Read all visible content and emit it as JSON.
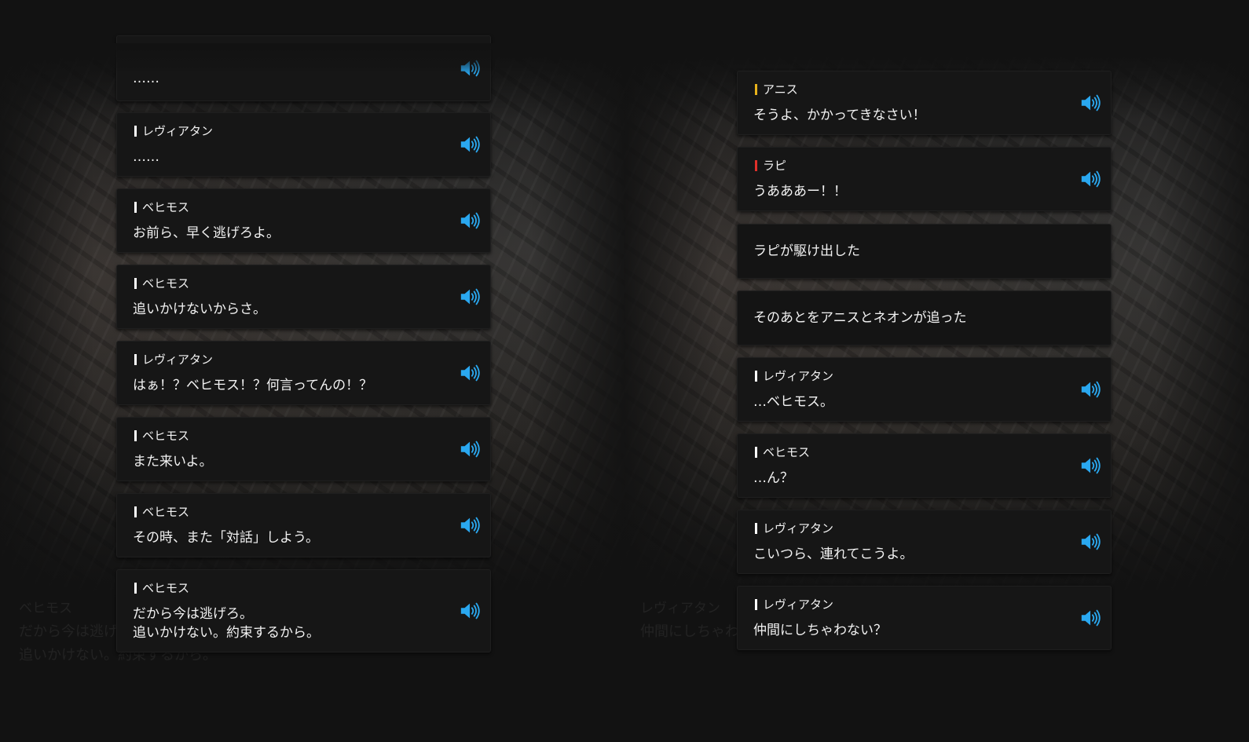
{
  "icons": {
    "speaker": "speaker-volume-icon"
  },
  "colors": {
    "accent": "#2aa8f0",
    "anis_mark": "#e8b21b",
    "rapi_mark": "#e0302a",
    "default_mark": "#ffffff"
  },
  "left": {
    "ghost": {
      "name": "ベヒモス",
      "line1": "だから今は逃げろ。",
      "line2": "追いかけない。約束するから。"
    },
    "messages": [
      {
        "speaker": "",
        "text": "……"
      },
      {
        "speaker": "レヴィアタン",
        "text": "……"
      },
      {
        "speaker": "ベヒモス",
        "text": "お前ら、早く逃げろよ。"
      },
      {
        "speaker": "ベヒモス",
        "text": "追いかけないからさ。"
      },
      {
        "speaker": "レヴィアタン",
        "text": "はぁ！？ベヒモス！？何言ってんの！？"
      },
      {
        "speaker": "ベヒモス",
        "text": "また来いよ。"
      },
      {
        "speaker": "ベヒモス",
        "text": "その時、また「対話」しよう。"
      },
      {
        "speaker": "ベヒモス",
        "text": "だから今は逃げろ。\n追いかけない。約束するから。"
      }
    ]
  },
  "right": {
    "ghost": {
      "name": "レヴィアタン",
      "line1": "仲間にしちゃわない？"
    },
    "messages": [
      {
        "speaker": "アニス",
        "text": "そうよ、かかってきなさい！"
      },
      {
        "speaker": "ラピ",
        "text": "うあああー！！"
      },
      {
        "speaker": "",
        "text": "ラピが駆け出した"
      },
      {
        "speaker": "",
        "text": "そのあとをアニスとネオンが追った"
      },
      {
        "speaker": "レヴィアタン",
        "text": "…ベヒモス。"
      },
      {
        "speaker": "ベヒモス",
        "text": "…ん？"
      },
      {
        "speaker": "レヴィアタン",
        "text": "こいつら、連れてこうよ。"
      },
      {
        "speaker": "レヴィアタン",
        "text": "仲間にしちゃわない？"
      }
    ]
  }
}
